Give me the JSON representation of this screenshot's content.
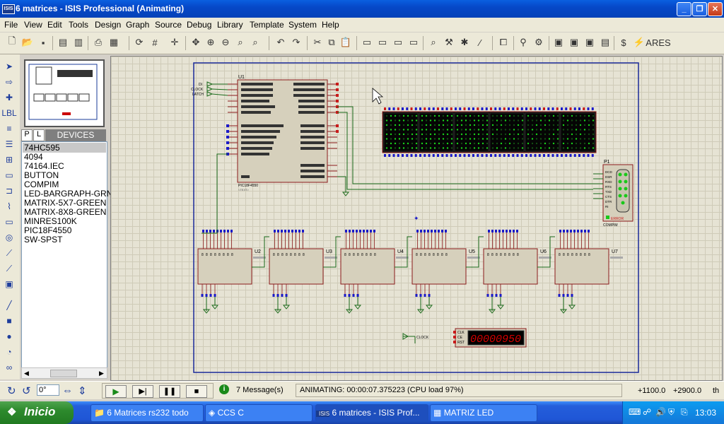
{
  "window": {
    "title": "6 matrices - ISIS Professional (Animating)",
    "app_icon": "ISIS",
    "controls": [
      "minimize-icon",
      "maximize-icon",
      "close-icon"
    ]
  },
  "menubar": [
    "File",
    "View",
    "Edit",
    "Tools",
    "Design",
    "Graph",
    "Source",
    "Debug",
    "Library",
    "Template",
    "System",
    "Help"
  ],
  "overview_panel": {
    "label": "overview"
  },
  "device_panel": {
    "tab_p": "P",
    "tab_l": "L",
    "header": "DEVICES",
    "items": [
      "74HC595",
      "4094",
      "74164.IEC",
      "BUTTON",
      "COMPIM",
      "LED-BARGRAPH-GRN",
      "MATRIX-5X7-GREEN",
      "MATRIX-8X8-GREEN",
      "MINRES100K",
      "PIC18F4550",
      "SW-SPST"
    ],
    "selected_index": 0
  },
  "schematic": {
    "mcu": {
      "ref": "U1",
      "part": "PIC18F4550",
      "text": "<TEXT>"
    },
    "com_port": {
      "ref": "P1",
      "part": "COMPIM",
      "pins": [
        "DCD",
        "DSR",
        "RXD",
        "RTS",
        "TXD",
        "CTS",
        "DTR",
        "RI"
      ],
      "error": "ERROR"
    },
    "registers": [
      {
        "ref": "U2"
      },
      {
        "ref": "U3"
      },
      {
        "ref": "U4"
      },
      {
        "ref": "U5"
      },
      {
        "ref": "U6"
      },
      {
        "ref": "U7"
      }
    ],
    "mcu_inputs": [
      "DI",
      "CLOCK",
      "LATCH"
    ],
    "clock_label": "CLOCK",
    "counter_pins": [
      "CLK",
      "CE",
      "RST"
    ],
    "counter_value": "00000950",
    "matrix_count": 6
  },
  "statusbar": {
    "rotation": "0°",
    "messages": "7 Message(s)",
    "status": "ANIMATING: 00:00:07.375223 (CPU load 97%)",
    "coord_x": "+1100.0",
    "coord_y": "+2900.0",
    "unit": "th"
  },
  "taskbar": {
    "start": "Inicio",
    "tasks": [
      "6 Matrices rs232 todo",
      "CCS C",
      "6 matrices - ISIS Prof...",
      "MATRIZ LED"
    ],
    "active_task": 2,
    "clock": "13:03"
  }
}
